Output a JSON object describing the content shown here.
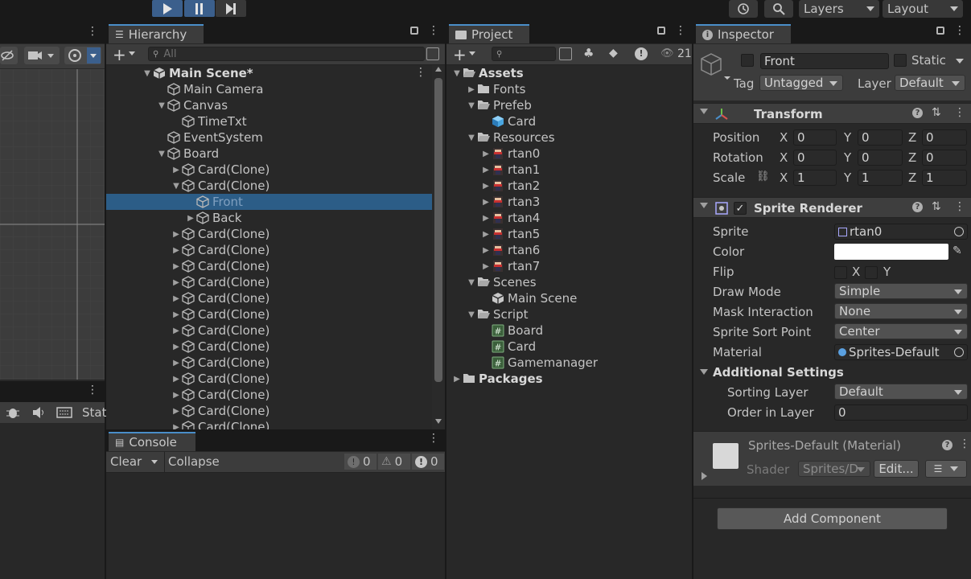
{
  "toolbar": {
    "layers_label": "Layers",
    "layout_label": "Layout"
  },
  "scene": {
    "stats_label": "Stat"
  },
  "hierarchy": {
    "tab_label": "Hierarchy",
    "search_placeholder": "All",
    "items": [
      {
        "label": "Main Scene*",
        "depth": 0,
        "expanded": true,
        "icon": "unity-scene-icon",
        "bold": true
      },
      {
        "label": "Main Camera",
        "depth": 1,
        "expanded": null,
        "icon": "gameobject-cube-icon"
      },
      {
        "label": "Canvas",
        "depth": 1,
        "expanded": true,
        "icon": "gameobject-cube-icon"
      },
      {
        "label": "TimeTxt",
        "depth": 2,
        "expanded": null,
        "icon": "gameobject-cube-icon"
      },
      {
        "label": "EventSystem",
        "depth": 1,
        "expanded": null,
        "icon": "gameobject-cube-icon"
      },
      {
        "label": "Board",
        "depth": 1,
        "expanded": true,
        "icon": "gameobject-cube-icon"
      },
      {
        "label": "Card(Clone)",
        "depth": 2,
        "expanded": false,
        "icon": "gameobject-cube-icon"
      },
      {
        "label": "Card(Clone)",
        "depth": 2,
        "expanded": true,
        "icon": "gameobject-cube-icon"
      },
      {
        "label": "Front",
        "depth": 3,
        "expanded": null,
        "icon": "gameobject-cube-icon",
        "selected": true
      },
      {
        "label": "Back",
        "depth": 3,
        "expanded": false,
        "icon": "gameobject-cube-icon"
      },
      {
        "label": "Card(Clone)",
        "depth": 2,
        "expanded": false,
        "icon": "gameobject-cube-icon"
      },
      {
        "label": "Card(Clone)",
        "depth": 2,
        "expanded": false,
        "icon": "gameobject-cube-icon"
      },
      {
        "label": "Card(Clone)",
        "depth": 2,
        "expanded": false,
        "icon": "gameobject-cube-icon"
      },
      {
        "label": "Card(Clone)",
        "depth": 2,
        "expanded": false,
        "icon": "gameobject-cube-icon"
      },
      {
        "label": "Card(Clone)",
        "depth": 2,
        "expanded": false,
        "icon": "gameobject-cube-icon"
      },
      {
        "label": "Card(Clone)",
        "depth": 2,
        "expanded": false,
        "icon": "gameobject-cube-icon"
      },
      {
        "label": "Card(Clone)",
        "depth": 2,
        "expanded": false,
        "icon": "gameobject-cube-icon"
      },
      {
        "label": "Card(Clone)",
        "depth": 2,
        "expanded": false,
        "icon": "gameobject-cube-icon"
      },
      {
        "label": "Card(Clone)",
        "depth": 2,
        "expanded": false,
        "icon": "gameobject-cube-icon"
      },
      {
        "label": "Card(Clone)",
        "depth": 2,
        "expanded": false,
        "icon": "gameobject-cube-icon"
      },
      {
        "label": "Card(Clone)",
        "depth": 2,
        "expanded": false,
        "icon": "gameobject-cube-icon"
      },
      {
        "label": "Card(Clone)",
        "depth": 2,
        "expanded": false,
        "icon": "gameobject-cube-icon"
      },
      {
        "label": "Card(Clone)",
        "depth": 2,
        "expanded": false,
        "icon": "gameobject-cube-icon"
      }
    ]
  },
  "console": {
    "tab_label": "Console",
    "clear_label": "Clear",
    "collapse_label": "Collapse",
    "info_count": "0",
    "warning_count": "0",
    "error_count": "0"
  },
  "project": {
    "tab_label": "Project",
    "hidden_count": "21",
    "items": [
      {
        "label": "Assets",
        "depth": 0,
        "expanded": true,
        "icon": "folder-open-icon",
        "bold": true
      },
      {
        "label": "Fonts",
        "depth": 1,
        "expanded": false,
        "icon": "folder-icon"
      },
      {
        "label": "Prefeb",
        "depth": 1,
        "expanded": true,
        "icon": "folder-open-icon"
      },
      {
        "label": "Card",
        "depth": 2,
        "expanded": null,
        "icon": "prefab-cube-icon"
      },
      {
        "label": "Resources",
        "depth": 1,
        "expanded": true,
        "icon": "folder-open-icon"
      },
      {
        "label": "rtan0",
        "depth": 2,
        "expanded": false,
        "icon": "sprite-thumbnail-icon"
      },
      {
        "label": "rtan1",
        "depth": 2,
        "expanded": false,
        "icon": "sprite-thumbnail-icon"
      },
      {
        "label": "rtan2",
        "depth": 2,
        "expanded": false,
        "icon": "sprite-thumbnail-icon"
      },
      {
        "label": "rtan3",
        "depth": 2,
        "expanded": false,
        "icon": "sprite-thumbnail-icon"
      },
      {
        "label": "rtan4",
        "depth": 2,
        "expanded": false,
        "icon": "sprite-thumbnail-icon"
      },
      {
        "label": "rtan5",
        "depth": 2,
        "expanded": false,
        "icon": "sprite-thumbnail-icon"
      },
      {
        "label": "rtan6",
        "depth": 2,
        "expanded": false,
        "icon": "sprite-thumbnail-icon"
      },
      {
        "label": "rtan7",
        "depth": 2,
        "expanded": false,
        "icon": "sprite-thumbnail-icon"
      },
      {
        "label": "Scenes",
        "depth": 1,
        "expanded": true,
        "icon": "folder-open-icon"
      },
      {
        "label": "Main Scene",
        "depth": 2,
        "expanded": null,
        "icon": "unity-scene-icon"
      },
      {
        "label": "Script",
        "depth": 1,
        "expanded": true,
        "icon": "folder-open-icon"
      },
      {
        "label": "Board",
        "depth": 2,
        "expanded": null,
        "icon": "csharp-script-icon"
      },
      {
        "label": "Card",
        "depth": 2,
        "expanded": null,
        "icon": "csharp-script-icon"
      },
      {
        "label": "Gamemanager",
        "depth": 2,
        "expanded": null,
        "icon": "csharp-script-icon"
      },
      {
        "label": "Packages",
        "depth": 0,
        "expanded": false,
        "icon": "folder-icon",
        "bold": true
      }
    ]
  },
  "inspector": {
    "tab_label": "Inspector",
    "object_name": "Front",
    "static_label": "Static",
    "tag_label": "Tag",
    "tag_value": "Untagged",
    "layer_label": "Layer",
    "layer_value": "Default",
    "transform": {
      "title": "Transform",
      "position_label": "Position",
      "rotation_label": "Rotation",
      "scale_label": "Scale",
      "axis_x": "X",
      "axis_y": "Y",
      "axis_z": "Z",
      "position": {
        "x": "0",
        "y": "0",
        "z": "0"
      },
      "rotation": {
        "x": "0",
        "y": "0",
        "z": "0"
      },
      "scale": {
        "x": "1",
        "y": "1",
        "z": "1"
      }
    },
    "sprite_renderer": {
      "title": "Sprite Renderer",
      "sprite_label": "Sprite",
      "sprite_value": "rtan0",
      "color_label": "Color",
      "color_value": "#ffffff",
      "flip_label": "Flip",
      "flip_x": "X",
      "flip_y": "Y",
      "draw_mode_label": "Draw Mode",
      "draw_mode_value": "Simple",
      "mask_label": "Mask Interaction",
      "mask_value": "None",
      "sort_point_label": "Sprite Sort Point",
      "sort_point_value": "Center",
      "material_label": "Material",
      "material_value": "Sprites-Default",
      "additional_label": "Additional Settings",
      "sorting_layer_label": "Sorting Layer",
      "sorting_layer_value": "Default",
      "order_label": "Order in Layer",
      "order_value": "0"
    },
    "material": {
      "title": "Sprites-Default (Material)",
      "shader_label": "Shader",
      "shader_value": "Sprites/D",
      "edit_label": "Edit..."
    },
    "add_component_label": "Add Component"
  },
  "colors": {
    "accent": "#3b5f8c",
    "selection": "#2c5d87",
    "panel": "#282828"
  }
}
